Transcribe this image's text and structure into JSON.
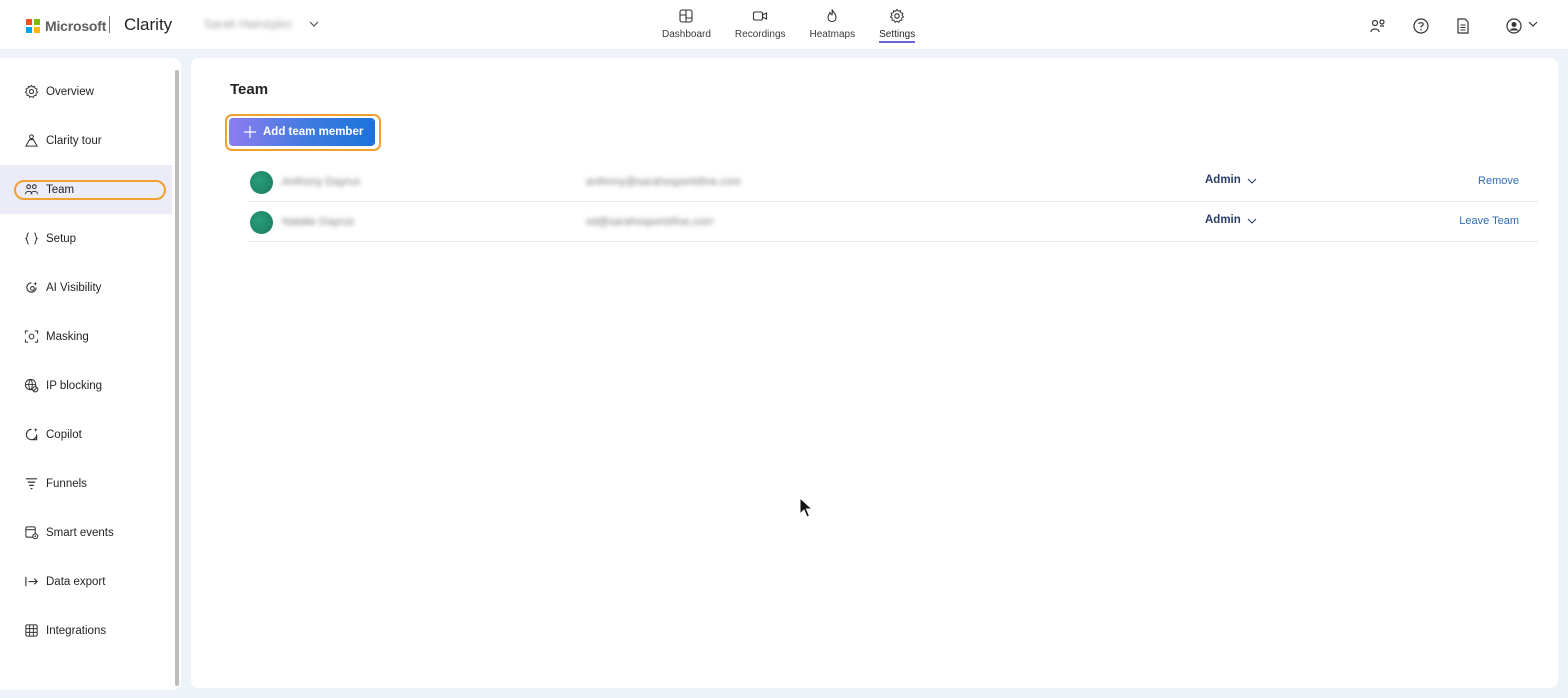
{
  "header": {
    "brand": "Microsoft",
    "product": "Clarity",
    "project_name": "Sarah Hairstyles",
    "nav": [
      {
        "label": "Dashboard",
        "icon": "dashboard-icon"
      },
      {
        "label": "Recordings",
        "icon": "video-camera-icon"
      },
      {
        "label": "Heatmaps",
        "icon": "flame-icon"
      },
      {
        "label": "Settings",
        "icon": "gear-icon",
        "active": true
      }
    ],
    "right_icons": [
      "people-share-icon",
      "help-icon",
      "document-icon",
      "account-icon"
    ]
  },
  "sidebar": {
    "items": [
      {
        "label": "Overview",
        "icon": "gear-icon"
      },
      {
        "label": "Clarity tour",
        "icon": "tour-icon"
      },
      {
        "label": "Team",
        "icon": "team-icon",
        "active": true
      },
      {
        "label": "Setup",
        "icon": "braces-icon"
      },
      {
        "label": "AI Visibility",
        "icon": "ai-visibility-icon"
      },
      {
        "label": "Masking",
        "icon": "masking-icon"
      },
      {
        "label": "IP blocking",
        "icon": "globe-block-icon"
      },
      {
        "label": "Copilot",
        "icon": "copilot-icon"
      },
      {
        "label": "Funnels",
        "icon": "funnel-icon"
      },
      {
        "label": "Smart events",
        "icon": "smart-events-icon"
      },
      {
        "label": "Data export",
        "icon": "export-icon"
      },
      {
        "label": "Integrations",
        "icon": "integrations-icon"
      }
    ]
  },
  "main": {
    "title": "Team",
    "add_button": "Add team member",
    "members": [
      {
        "name": "Anthony Dayrus",
        "email": "anthony@sarahssportsfine.com",
        "role": "Admin",
        "action": "Remove"
      },
      {
        "name": "Natalie Dayrus",
        "email": "sd@sarahssportsfine.com",
        "role": "Admin",
        "action": "Leave Team"
      }
    ]
  },
  "colors": {
    "accent": "#6b63d6",
    "button_gradient_start": "#8d7cf0",
    "button_gradient_end": "#1a73d9",
    "highlight": "#f0a030",
    "link": "#2c6cb8",
    "avatar": "#1b8666"
  }
}
